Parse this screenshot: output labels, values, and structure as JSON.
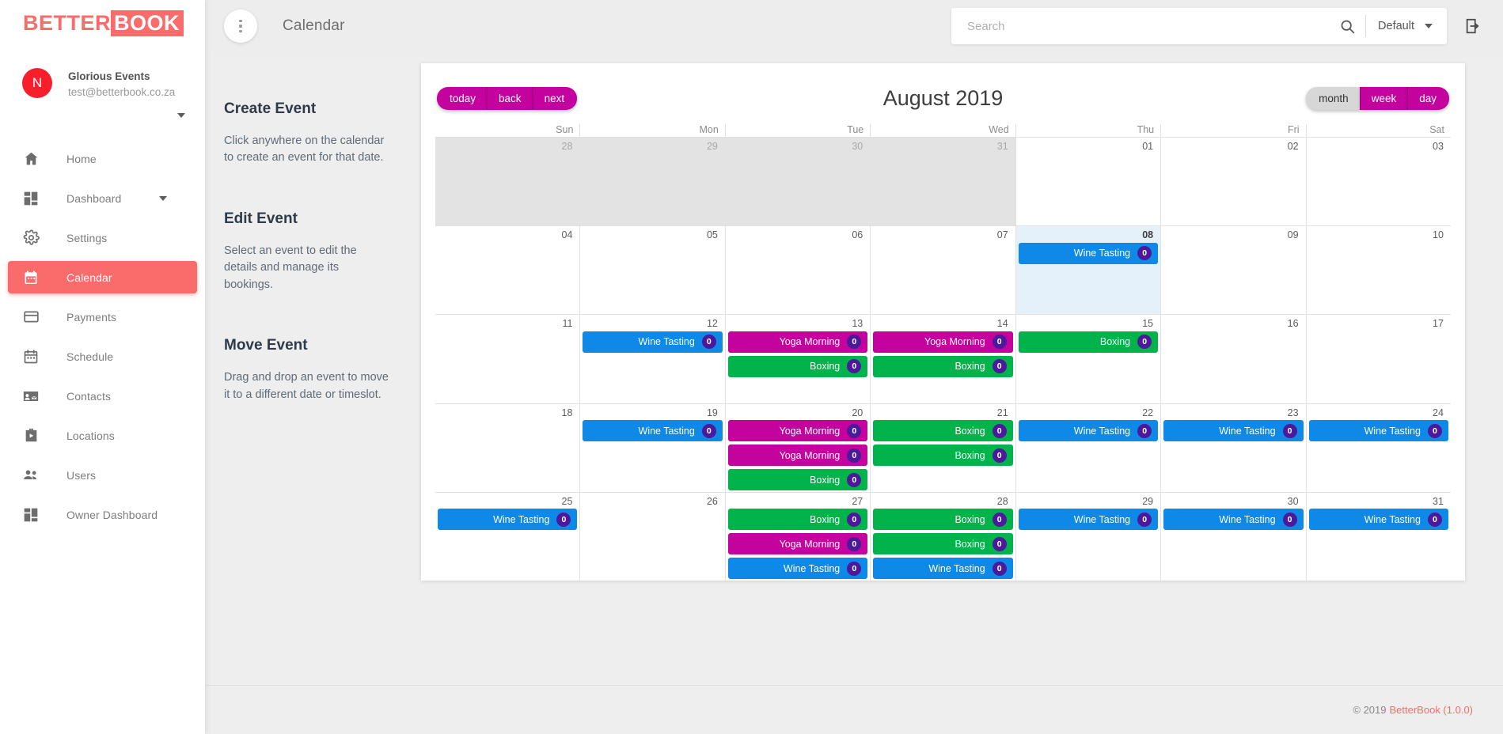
{
  "brand": {
    "logo_part1": "BETTER",
    "logo_part2": "BOOK",
    "accent_color": "#fa6b6b"
  },
  "account": {
    "avatar_initial": "N",
    "name": "Glorious Events",
    "email": "test@betterbook.co.za"
  },
  "sidebar": {
    "items": [
      {
        "label": "Home",
        "icon": "home-icon",
        "active": false,
        "caret": false
      },
      {
        "label": "Dashboard",
        "icon": "dashboard-icon",
        "active": false,
        "caret": true
      },
      {
        "label": "Settings",
        "icon": "gear-icon",
        "active": false,
        "caret": false
      },
      {
        "label": "Calendar",
        "icon": "calendar-icon",
        "active": true,
        "caret": false
      },
      {
        "label": "Payments",
        "icon": "credit-card-icon",
        "active": false,
        "caret": false
      },
      {
        "label": "Schedule",
        "icon": "schedule-icon",
        "active": false,
        "caret": false
      },
      {
        "label": "Contacts",
        "icon": "contacts-icon",
        "active": false,
        "caret": false
      },
      {
        "label": "Locations",
        "icon": "locations-icon",
        "active": false,
        "caret": false
      },
      {
        "label": "Users",
        "icon": "users-icon",
        "active": false,
        "caret": false
      },
      {
        "label": "Owner Dashboard",
        "icon": "dashboard-icon",
        "active": false,
        "caret": false
      }
    ]
  },
  "topbar": {
    "menu_icon": "more-vert-icon",
    "title": "Calendar",
    "search": {
      "value": "",
      "placeholder": "Search",
      "icon": "search-icon"
    },
    "filter": {
      "selected": "Default",
      "icon": "chevron-down-icon"
    },
    "logout_icon": "logout-icon"
  },
  "help": [
    {
      "heading": "Create Event",
      "body": "Click anywhere on the calendar to create an event for that date."
    },
    {
      "heading": "Edit Event",
      "body": "Select an event to edit the details and manage its bookings."
    },
    {
      "heading": "Move Event",
      "body": "Drag and drop an event to move it to a different date or timeslot."
    }
  ],
  "calendar": {
    "title": "August 2019",
    "nav_buttons": [
      {
        "label": "today",
        "active": false
      },
      {
        "label": "back",
        "active": false
      },
      {
        "label": "next",
        "active": false
      }
    ],
    "view_buttons": [
      {
        "label": "month",
        "active": true
      },
      {
        "label": "week",
        "active": false
      },
      {
        "label": "day",
        "active": false
      }
    ],
    "day_headers": [
      "Sun",
      "Mon",
      "Tue",
      "Wed",
      "Thu",
      "Fri",
      "Sat"
    ],
    "event_colors": {
      "Wine Tasting": "#0f89e8",
      "Yoga Morning": "#c4029e",
      "Boxing": "#00b34a"
    },
    "badge_color": "#4b1a9c",
    "weeks": [
      [
        {
          "day": "28",
          "other": true,
          "today": false,
          "events": []
        },
        {
          "day": "29",
          "other": true,
          "today": false,
          "events": []
        },
        {
          "day": "30",
          "other": true,
          "today": false,
          "events": []
        },
        {
          "day": "31",
          "other": true,
          "today": false,
          "events": []
        },
        {
          "day": "01",
          "other": false,
          "today": false,
          "events": []
        },
        {
          "day": "02",
          "other": false,
          "today": false,
          "events": []
        },
        {
          "day": "03",
          "other": false,
          "today": false,
          "events": []
        }
      ],
      [
        {
          "day": "04",
          "other": false,
          "today": false,
          "events": []
        },
        {
          "day": "05",
          "other": false,
          "today": false,
          "events": []
        },
        {
          "day": "06",
          "other": false,
          "today": false,
          "events": []
        },
        {
          "day": "07",
          "other": false,
          "today": false,
          "events": []
        },
        {
          "day": "08",
          "other": false,
          "today": true,
          "events": [
            {
              "title": "Wine Tasting",
              "count": "0"
            }
          ]
        },
        {
          "day": "09",
          "other": false,
          "today": false,
          "events": []
        },
        {
          "day": "10",
          "other": false,
          "today": false,
          "events": []
        }
      ],
      [
        {
          "day": "11",
          "other": false,
          "today": false,
          "events": []
        },
        {
          "day": "12",
          "other": false,
          "today": false,
          "events": [
            {
              "title": "Wine Tasting",
              "count": "0"
            }
          ]
        },
        {
          "day": "13",
          "other": false,
          "today": false,
          "events": [
            {
              "title": "Yoga Morning",
              "count": "0"
            },
            {
              "title": "Boxing",
              "count": "0"
            }
          ]
        },
        {
          "day": "14",
          "other": false,
          "today": false,
          "events": [
            {
              "title": "Yoga Morning",
              "count": "0"
            },
            {
              "title": "Boxing",
              "count": "0"
            }
          ]
        },
        {
          "day": "15",
          "other": false,
          "today": false,
          "events": [
            {
              "title": "Boxing",
              "count": "0"
            }
          ]
        },
        {
          "day": "16",
          "other": false,
          "today": false,
          "events": []
        },
        {
          "day": "17",
          "other": false,
          "today": false,
          "events": []
        }
      ],
      [
        {
          "day": "18",
          "other": false,
          "today": false,
          "events": []
        },
        {
          "day": "19",
          "other": false,
          "today": false,
          "events": [
            {
              "title": "Wine Tasting",
              "count": "0"
            }
          ]
        },
        {
          "day": "20",
          "other": false,
          "today": false,
          "events": [
            {
              "title": "Yoga Morning",
              "count": "0"
            },
            {
              "title": "Yoga Morning",
              "count": "0"
            },
            {
              "title": "Boxing",
              "count": "0"
            }
          ]
        },
        {
          "day": "21",
          "other": false,
          "today": false,
          "events": [
            {
              "title": "Boxing",
              "count": "0"
            },
            {
              "title": "Boxing",
              "count": "0"
            }
          ]
        },
        {
          "day": "22",
          "other": false,
          "today": false,
          "events": [
            {
              "title": "Wine Tasting",
              "count": "0"
            }
          ]
        },
        {
          "day": "23",
          "other": false,
          "today": false,
          "events": [
            {
              "title": "Wine Tasting",
              "count": "0"
            }
          ]
        },
        {
          "day": "24",
          "other": false,
          "today": false,
          "events": [
            {
              "title": "Wine Tasting",
              "count": "0"
            }
          ]
        }
      ],
      [
        {
          "day": "25",
          "other": false,
          "today": false,
          "events": [
            {
              "title": "Wine Tasting",
              "count": "0"
            }
          ]
        },
        {
          "day": "26",
          "other": false,
          "today": false,
          "events": []
        },
        {
          "day": "27",
          "other": false,
          "today": false,
          "events": [
            {
              "title": "Boxing",
              "count": "0"
            },
            {
              "title": "Yoga Morning",
              "count": "0"
            },
            {
              "title": "Wine Tasting",
              "count": "0"
            }
          ]
        },
        {
          "day": "28",
          "other": false,
          "today": false,
          "events": [
            {
              "title": "Boxing",
              "count": "0"
            },
            {
              "title": "Boxing",
              "count": "0"
            },
            {
              "title": "Wine Tasting",
              "count": "0"
            }
          ]
        },
        {
          "day": "29",
          "other": false,
          "today": false,
          "events": [
            {
              "title": "Wine Tasting",
              "count": "0"
            }
          ]
        },
        {
          "day": "30",
          "other": false,
          "today": false,
          "events": [
            {
              "title": "Wine Tasting",
              "count": "0"
            }
          ]
        },
        {
          "day": "31",
          "other": false,
          "today": false,
          "events": [
            {
              "title": "Wine Tasting",
              "count": "0"
            }
          ]
        }
      ]
    ]
  },
  "footer": {
    "copyright": "© 2019",
    "brand": "BetterBook (1.0.0)"
  }
}
